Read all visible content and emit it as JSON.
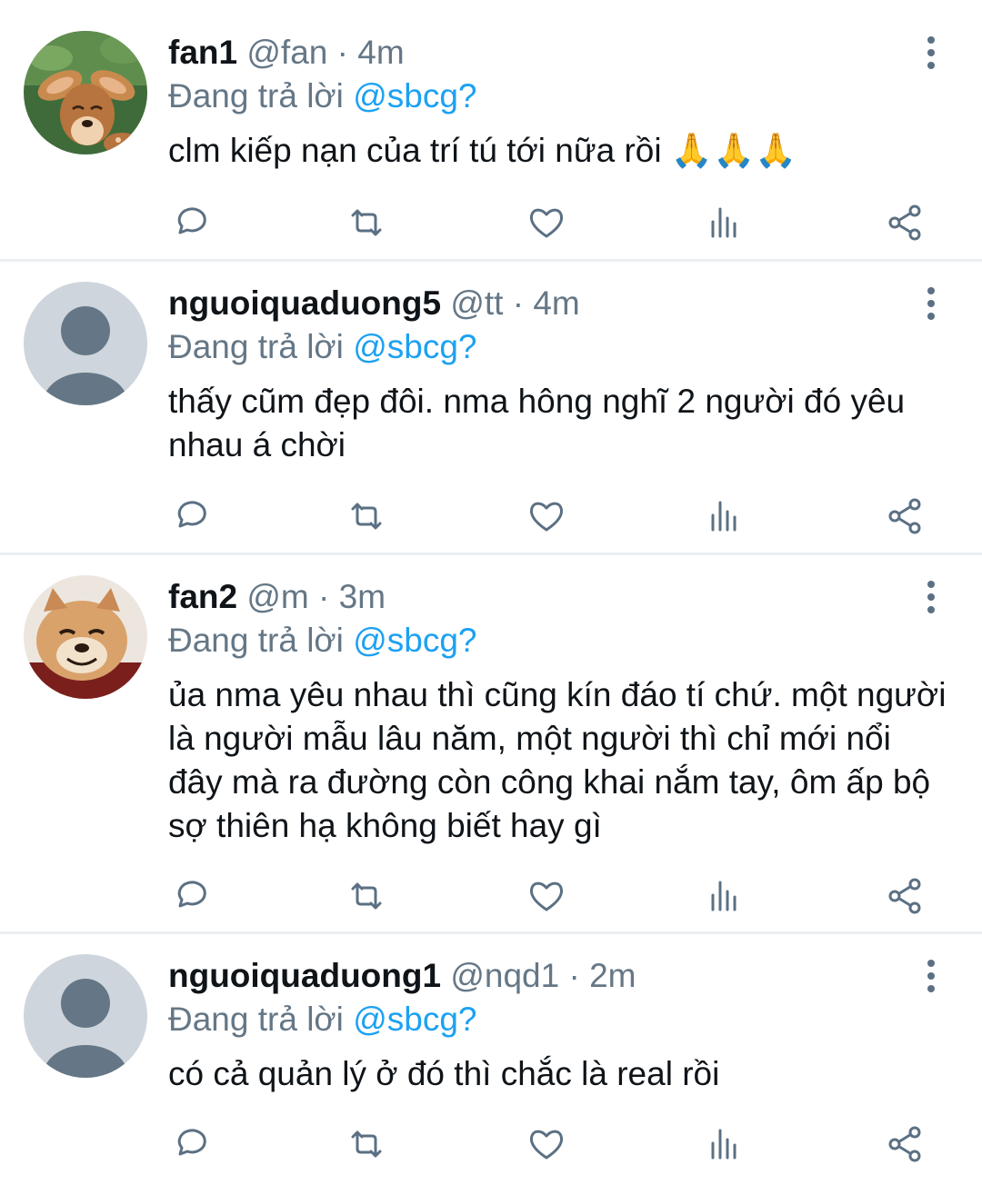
{
  "replying_label": "Đang trả lời",
  "tweets": [
    {
      "name": "fan1",
      "handle": "@fan",
      "sep": "·",
      "time": "4m",
      "reply_to": "@sbcg?",
      "text": "clm kiếp nạn của trí tú tới nữa rồi 🙏🙏🙏",
      "avatar": "fawn-cartoon-avatar"
    },
    {
      "name": "nguoiquaduong5",
      "handle": "@tt",
      "sep": "·",
      "time": "4m",
      "reply_to": "@sbcg?",
      "text": "thấy cũm đẹp đôi. nma hông nghĩ 2 người đó yêu nhau á chời",
      "avatar": "default-user-avatar"
    },
    {
      "name": "fan2",
      "handle": "@m",
      "sep": "·",
      "time": "3m",
      "reply_to": "@sbcg?",
      "text": "ủa nma yêu nhau thì cũng kín đáo tí chứ. một người là người mẫu lâu năm, một người thì chỉ mới nổi đây mà ra đường còn công khai nắm tay, ôm ấp bộ sợ thiên hạ không biết hay gì",
      "avatar": "smiling-dog-avatar"
    },
    {
      "name": "nguoiquaduong1",
      "handle": "@nqd1",
      "sep": "·",
      "time": "2m",
      "reply_to": "@sbcg?",
      "text": "có cả quản lý ở đó thì chắc là real rồi",
      "avatar": "default-user-avatar"
    }
  ],
  "colors": {
    "text": "#0f1419",
    "muted": "#657786",
    "mention": "#1da1f2",
    "divider": "#eceff1",
    "icon": "#5b7083"
  },
  "icons": [
    "reply-icon",
    "retweet-icon",
    "like-icon",
    "stats-icon",
    "share-icon",
    "more-options-icon"
  ]
}
